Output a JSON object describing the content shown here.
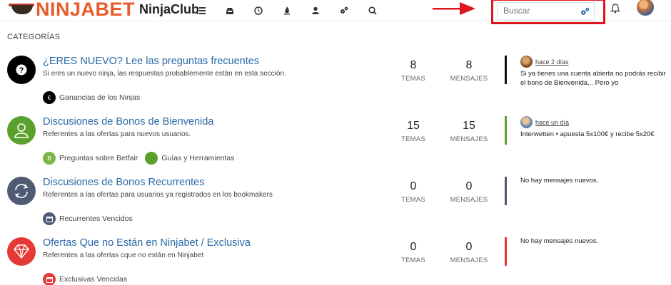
{
  "header": {
    "logo_text": "NINJABET",
    "club_text": "NinjaClub",
    "nav_icons": [
      "list-icon",
      "inbox-icon",
      "clock-icon",
      "fire-icon",
      "user-icon",
      "cogs-icon",
      "search-icon"
    ],
    "search_placeholder": "Buscar"
  },
  "colors": {
    "brand_orange": "#e85b2a",
    "link_blue": "#2b6aa6",
    "highlight_red": "#e0141e"
  },
  "section_title": "CATEGORÍAS",
  "categories": [
    {
      "title": "¿ERES NUEVO? Lee las preguntas frecuentes",
      "description": "Si eres un nuevo ninja, las respuestas probablemente están en esta sección.",
      "icon": "question-icon",
      "color": "#000000",
      "subcategories": [
        {
          "label": "Ganancias de los Ninjas",
          "icon": "euro-icon",
          "color": "#000000"
        }
      ],
      "topics": "8",
      "posts": "8",
      "last_post": {
        "time": "hace 2 días",
        "text": "Si ya tienes una cuenta abierta no podrás recibir el bono de Bienvenida... Pero yo"
      }
    },
    {
      "title": "Discusiones de Bonos de Bienvenida",
      "description": "Referentes a las ofertas para nuevos usuarios.",
      "icon": "user-icon",
      "color": "#5aa02c",
      "subcategories": [
        {
          "label": "Preguntas sobre Betfair",
          "icon": "b-icon",
          "color": "#7ab648"
        },
        {
          "label": "Guías y Herramientas",
          "icon": "circle-icon",
          "color": "#5aa02c"
        }
      ],
      "topics": "15",
      "posts": "15",
      "last_post": {
        "time": "hace un día",
        "text": "Interwetten • apuesta 5x100€ y recibe 5x20€"
      }
    },
    {
      "title": "Discusiones de Bonos Recurrentes",
      "description": "Referentes a las ofertas para usuarios ya registrados en los bookmakers",
      "icon": "refresh-icon",
      "color": "#4f5b73",
      "subcategories": [
        {
          "label": "Recurrentes Vencidos",
          "icon": "calendar-icon",
          "color": "#4f5b73"
        }
      ],
      "topics": "0",
      "posts": "0",
      "last_post": {
        "text": "No hay mensajes nuevos."
      }
    },
    {
      "title": "Ofertas Que no Están en Ninjabet / Exclusiva",
      "description": "Referentes a las ofertas cque no están en Ninjabet",
      "icon": "diamond-icon",
      "color": "#e53935",
      "subcategories": [
        {
          "label": "Exclusivas Vencidas",
          "icon": "calendar-icon",
          "color": "#e53935"
        }
      ],
      "topics": "0",
      "posts": "0",
      "last_post": {
        "text": "No hay mensajes nuevos."
      }
    }
  ],
  "labels": {
    "topics": "TEMAS",
    "posts": "MENSAJES"
  }
}
